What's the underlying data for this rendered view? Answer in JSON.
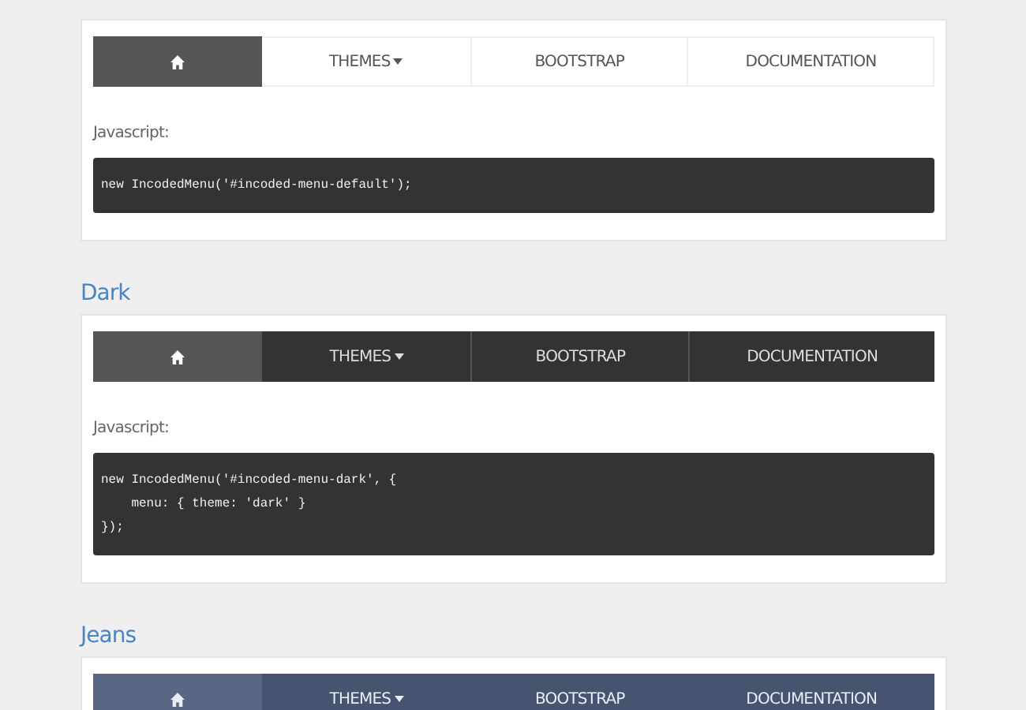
{
  "sections": [
    {
      "kind": "default",
      "menu": [
        {
          "kind": "home",
          "selected": true
        },
        {
          "kind": "link",
          "label": "THEMES",
          "dropdown": true,
          "selected": false
        },
        {
          "kind": "link",
          "label": "BOOTSTRAP",
          "dropdown": false,
          "selected": false
        },
        {
          "kind": "link",
          "label": "DOCUMENTATION",
          "dropdown": false,
          "selected": false
        }
      ],
      "code_label": "Javascript:",
      "code": [
        "new IncodedMenu('#incoded-menu-default');"
      ]
    },
    {
      "heading": "Dark",
      "kind": "dark",
      "menu": [
        {
          "kind": "home",
          "selected": true
        },
        {
          "kind": "link",
          "label": "THEMES",
          "dropdown": true,
          "selected": false
        },
        {
          "kind": "link",
          "label": "BOOTSTRAP",
          "dropdown": false,
          "selected": false
        },
        {
          "kind": "link",
          "label": "DOCUMENTATION",
          "dropdown": false,
          "selected": false
        }
      ],
      "code_label": "Javascript:",
      "code": [
        "new IncodedMenu('#incoded-menu-dark', {",
        "    menu: { theme: 'dark' }",
        "});"
      ]
    },
    {
      "heading": "Jeans",
      "kind": "jeans",
      "menu": [
        {
          "kind": "home",
          "selected": true
        },
        {
          "kind": "link",
          "label": "THEMES",
          "dropdown": true,
          "selected": false
        },
        {
          "kind": "link",
          "label": "BOOTSTRAP",
          "dropdown": false,
          "selected": false
        },
        {
          "kind": "link",
          "label": "DOCUMENTATION",
          "dropdown": false,
          "selected": false
        }
      ]
    }
  ]
}
